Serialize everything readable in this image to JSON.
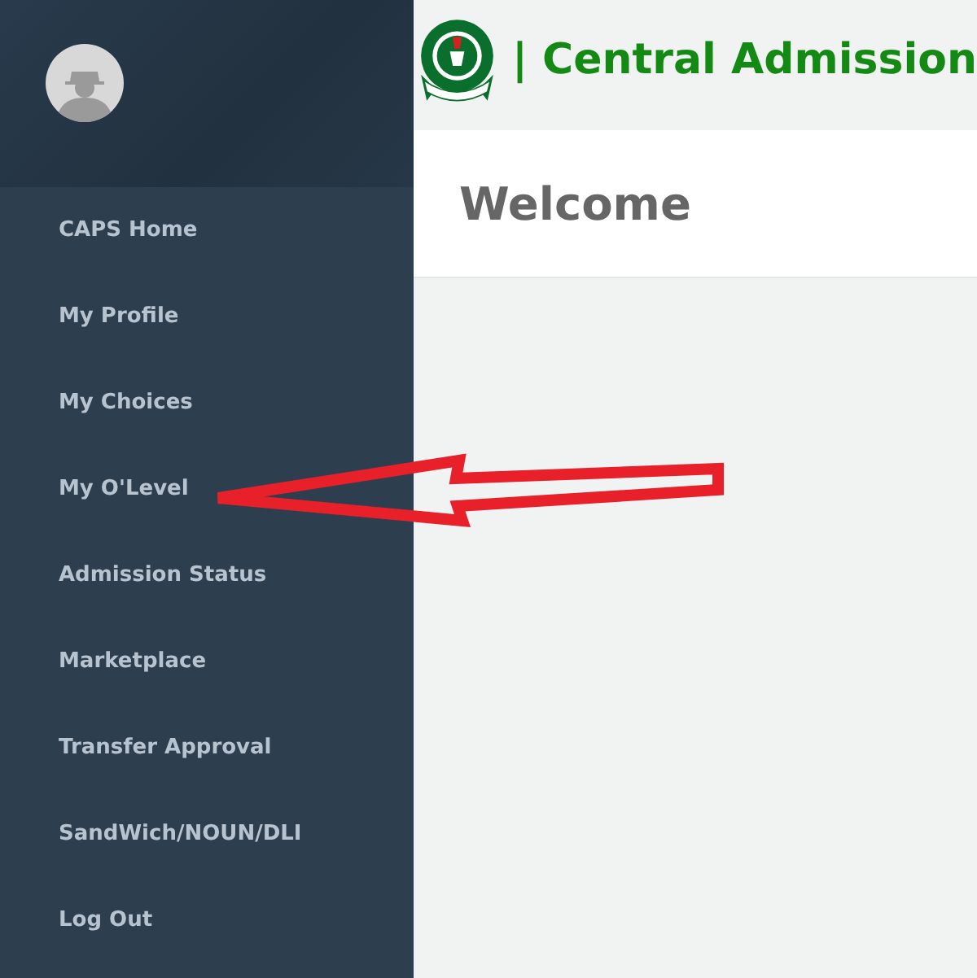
{
  "header": {
    "title": "| Central Admission"
  },
  "panel": {
    "title": "Welcome"
  },
  "sidebar": {
    "items": [
      {
        "label": "CAPS Home"
      },
      {
        "label": "My Profile"
      },
      {
        "label": "My Choices"
      },
      {
        "label": "My O'Level"
      },
      {
        "label": "Admission Status"
      },
      {
        "label": "Marketplace"
      },
      {
        "label": "Transfer Approval"
      },
      {
        "label": "SandWich/NOUN/DLI"
      },
      {
        "label": "Log Out"
      }
    ]
  }
}
